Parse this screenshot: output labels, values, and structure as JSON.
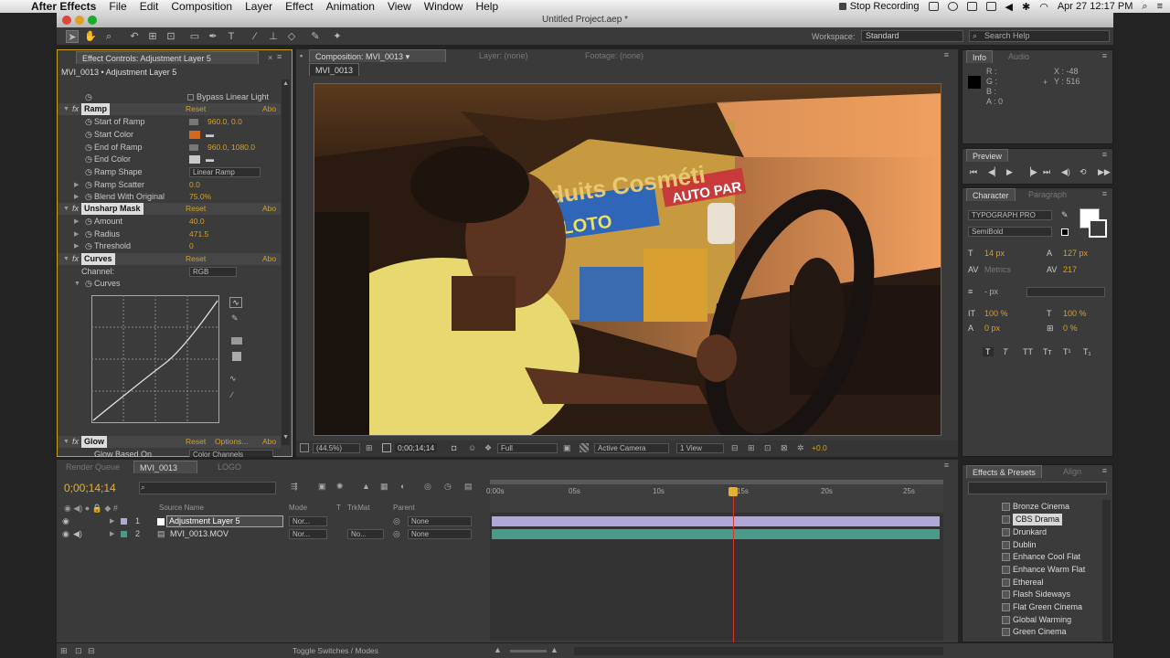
{
  "menubar": {
    "app": "After Effects",
    "items": [
      "File",
      "Edit",
      "Composition",
      "Layer",
      "Effect",
      "Animation",
      "View",
      "Window",
      "Help"
    ],
    "stop_recording": "Stop Recording",
    "datetime": "Apr 27  12:17 PM"
  },
  "window_title": "Untitled Project.aep *",
  "toolbar": {
    "workspace_label": "Workspace:",
    "workspace_value": "Standard",
    "search_placeholder": "Search Help"
  },
  "effect_controls": {
    "tab": "Effect Controls: Adjustment Layer 5",
    "subtitle": "MVI_0013 • Adjustment Layer 5",
    "bypass_linear_light": "Bypass Linear Light",
    "ramp": {
      "name": "Ramp",
      "reset": "Reset",
      "about": "Abo",
      "start_of_ramp": "Start of Ramp",
      "start_of_ramp_val": "960.0, 0.0",
      "start_color": "Start Color",
      "start_color_hex": "#d2691e",
      "end_of_ramp": "End of Ramp",
      "end_of_ramp_val": "960.0, 1080.0",
      "end_color": "End Color",
      "end_color_hex": "#c8c8c8",
      "ramp_shape": "Ramp Shape",
      "ramp_shape_val": "Linear Ramp",
      "ramp_scatter": "Ramp Scatter",
      "ramp_scatter_val": "0.0",
      "blend": "Blend With Original",
      "blend_val": "75.0%"
    },
    "unsharp": {
      "name": "Unsharp Mask",
      "reset": "Reset",
      "about": "Abo",
      "amount": "Amount",
      "amount_val": "40.0",
      "radius": "Radius",
      "radius_val": "471.5",
      "threshold": "Threshold",
      "threshold_val": "0"
    },
    "curves": {
      "name": "Curves",
      "reset": "Reset",
      "about": "Abo",
      "channel": "Channel:",
      "channel_val": "RGB",
      "curves_label": "Curves"
    },
    "glow": {
      "name": "Glow",
      "reset": "Reset",
      "options": "Options...",
      "about": "Abo",
      "glow_based_on": "Glow Based On",
      "glow_based_val": "Color Channels"
    }
  },
  "composition": {
    "tab": "Composition: MVI_0013",
    "layer_tab": "Layer: (none)",
    "footage_tab": "Footage: (none)",
    "subtab": "MVI_0013",
    "zoom": "(44.5%)",
    "timecode": "0;00;14;14",
    "resolution": "Full",
    "camera": "Active Camera",
    "view": "1 View",
    "exposure": "+0.0"
  },
  "info": {
    "tab": "Info",
    "audio_tab": "Audio",
    "r": "R :",
    "g": "G :",
    "b": "B :",
    "a": "A : 0",
    "x": "X : -48",
    "y": "Y : 516"
  },
  "preview": {
    "tab": "Preview"
  },
  "character": {
    "tab": "Character",
    "paragraph_tab": "Paragraph",
    "font": "TYPOGRAPH PRO",
    "style": "SemiBold",
    "size": "14 px",
    "leading": "127 px",
    "kerning": "Metrics",
    "tracking": "217",
    "stroke": "- px",
    "vscale": "100 %",
    "hscale": "100 %",
    "baseline": "0 px",
    "tsume": "0 %"
  },
  "effects_presets": {
    "tab": "Effects & Presets",
    "align_tab": "Align",
    "items": [
      "Bronze Cinema",
      "CBS Drama",
      "Drunkard",
      "Dublin",
      "Enhance Cool Flat",
      "Enhance Warm Flat",
      "Ethereal",
      "Flash Sideways",
      "Flat Green Cinema",
      "Global Warming",
      "Green Cinema"
    ],
    "selected": "CBS Drama"
  },
  "timeline": {
    "render_queue_tab": "Render Queue",
    "comp_tab": "MVI_0013",
    "logo_tab": "LOGO",
    "timecode": "0;00;14;14",
    "columns": {
      "source_name": "Source Name",
      "mode": "Mode",
      "t": "T",
      "trkmat": "TrkMat",
      "parent": "Parent"
    },
    "layers": [
      {
        "num": "1",
        "name": "Adjustment Layer 5",
        "mode": "Nor...",
        "trkmat": "",
        "parent": "None",
        "color": "#b0a8d8"
      },
      {
        "num": "2",
        "name": "MVI_0013.MOV",
        "mode": "Nor...",
        "trkmat": "No...",
        "parent": "None",
        "color": "#4a9a8a"
      }
    ],
    "ruler": [
      "0:00s",
      "05s",
      "10s",
      "15s",
      "20s",
      "25s"
    ],
    "playhead_seconds": 14.5,
    "duration_seconds": 27
  },
  "bottombar": {
    "toggle": "Toggle Switches / Modes"
  }
}
